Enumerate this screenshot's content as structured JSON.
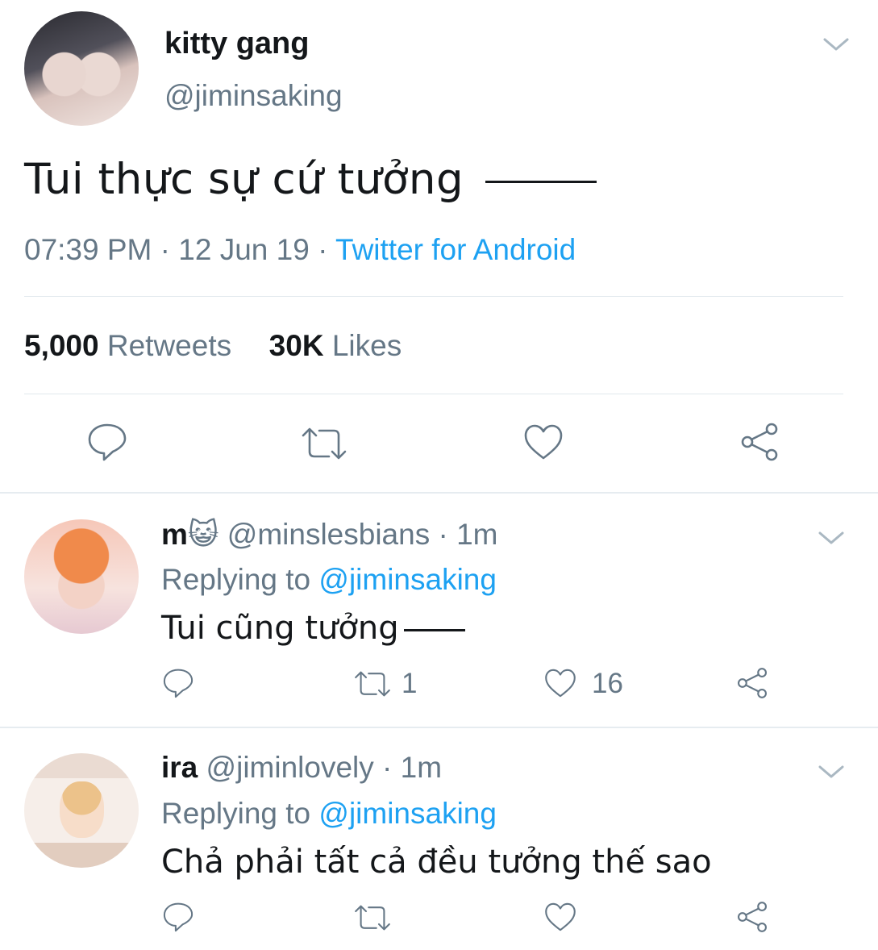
{
  "tweet": {
    "display_name": "kitty gang",
    "handle": "@jiminsaking",
    "text": "Tui thực sự cứ tưởng",
    "time": "07:39 PM",
    "date": "12 Jun 19",
    "separator": "·",
    "source": "Twitter for Android",
    "retweet_count": "5,000",
    "retweet_label": "Retweets",
    "like_count": "30K",
    "like_label": "Likes"
  },
  "replies": [
    {
      "display_name": "m",
      "name_emoji": "😺",
      "handle": "@minslesbians",
      "age": "1m",
      "replying_label": "Replying to",
      "replying_to": "@jiminsaking",
      "text": "Tui cũng tưởng",
      "retweets": "1",
      "likes": "16"
    },
    {
      "display_name": "ira",
      "handle": "@jiminlovely",
      "age": "1m",
      "replying_label": "Replying to",
      "replying_to": "@jiminsaking",
      "text": "Chả phải tất cả đều tưởng thế sao",
      "retweets": "",
      "likes": ""
    }
  ],
  "icons": {
    "menu": "chevron-down-icon",
    "reply": "reply-icon",
    "retweet": "retweet-icon",
    "like": "heart-icon",
    "share": "share-icon"
  },
  "colors": {
    "link": "#1da1f2",
    "secondary_text": "#657786",
    "divider": "#e1e8ed"
  }
}
